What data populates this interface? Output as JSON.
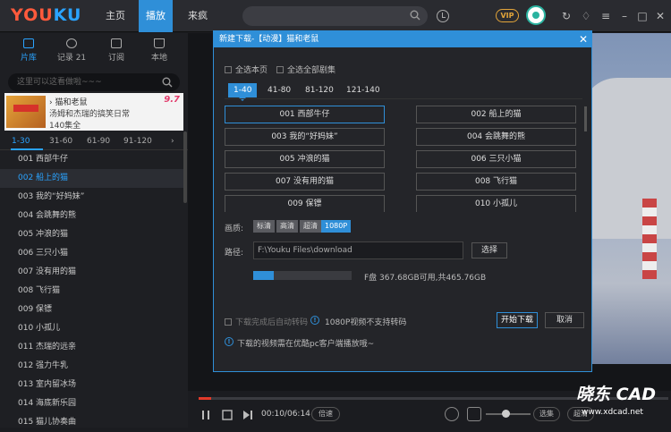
{
  "brand": {
    "logo_a": "YOU",
    "logo_b": "KU"
  },
  "nav": {
    "tabs": [
      "主页",
      "播放",
      "来疯"
    ],
    "active": 1
  },
  "topbar": {
    "vip_label": "VIP"
  },
  "sidebar": {
    "tabs": [
      {
        "label": "片库",
        "icon": "library-icon"
      },
      {
        "label": "记录 21",
        "icon": "history-icon"
      },
      {
        "label": "订阅",
        "icon": "subscribe-icon"
      },
      {
        "label": "本地",
        "icon": "local-icon"
      }
    ],
    "search_placeholder": "这里可以这看做啦~~~",
    "show": {
      "title": "› 猫和老鼠",
      "rating": "9.7",
      "desc": "汤姆和杰瑞的搞笑日常",
      "count": "140集全"
    },
    "range_tabs": [
      "1-30",
      "31-60",
      "61-90",
      "91-120",
      "›"
    ],
    "episodes": [
      "001 西部牛仔",
      "002 船上的猫",
      "003 我的“好妈妹”",
      "004 会跳舞的熊",
      "005 冲浪的猫",
      "006 三只小猫",
      "007 没有用的猫",
      "008 飞行猫",
      "009 保镖",
      "010 小孤儿",
      "011 杰瑞的远亲",
      "012 强力牛乳",
      "013 室内留冰场",
      "014 海底新乐园",
      "015 猫儿协奏曲"
    ],
    "active_episode": 1
  },
  "dialog": {
    "title": "新建下载-【动漫】猫和老鼠",
    "close": "✕",
    "select_page": "全选本页",
    "select_all": "全选全部剧集",
    "ranges": [
      "1-40",
      "41-80",
      "81-120",
      "121-140"
    ],
    "episodes": [
      "001 西部牛仔",
      "002 船上的猫",
      "003 我的“好妈妹”",
      "004 会跳舞的熊",
      "005 冲浪的猫",
      "006 三只小猫",
      "007 没有用的猫",
      "008 飞行猫",
      "009 保镖",
      "010 小孤儿"
    ],
    "quality_label": "画质:",
    "qualities": [
      "标清",
      "高清",
      "超清",
      "1080P"
    ],
    "path_label": "路径:",
    "path_value": "F:\\Youku Files\\download",
    "choose_button": "选择",
    "disk_info": "F盘 367.68GB可用,共465.76GB",
    "disk_used_fraction": 0.21,
    "auto_transcode": "下载完成后自动转码",
    "transcode_warning": "1080P视频不支持转码",
    "start_button": "开始下载",
    "cancel_button": "取消",
    "footer_note": "下载的视频需在优酷pc客户端播放哦~"
  },
  "player": {
    "time": "00:10/06:14",
    "speed_label": "倍速",
    "select_label": "选集",
    "hd_label": "超清",
    "progress_fraction": 0.027
  },
  "watermark": {
    "line1": "晓东 CAD",
    "line2": "www.xdcad.net"
  }
}
